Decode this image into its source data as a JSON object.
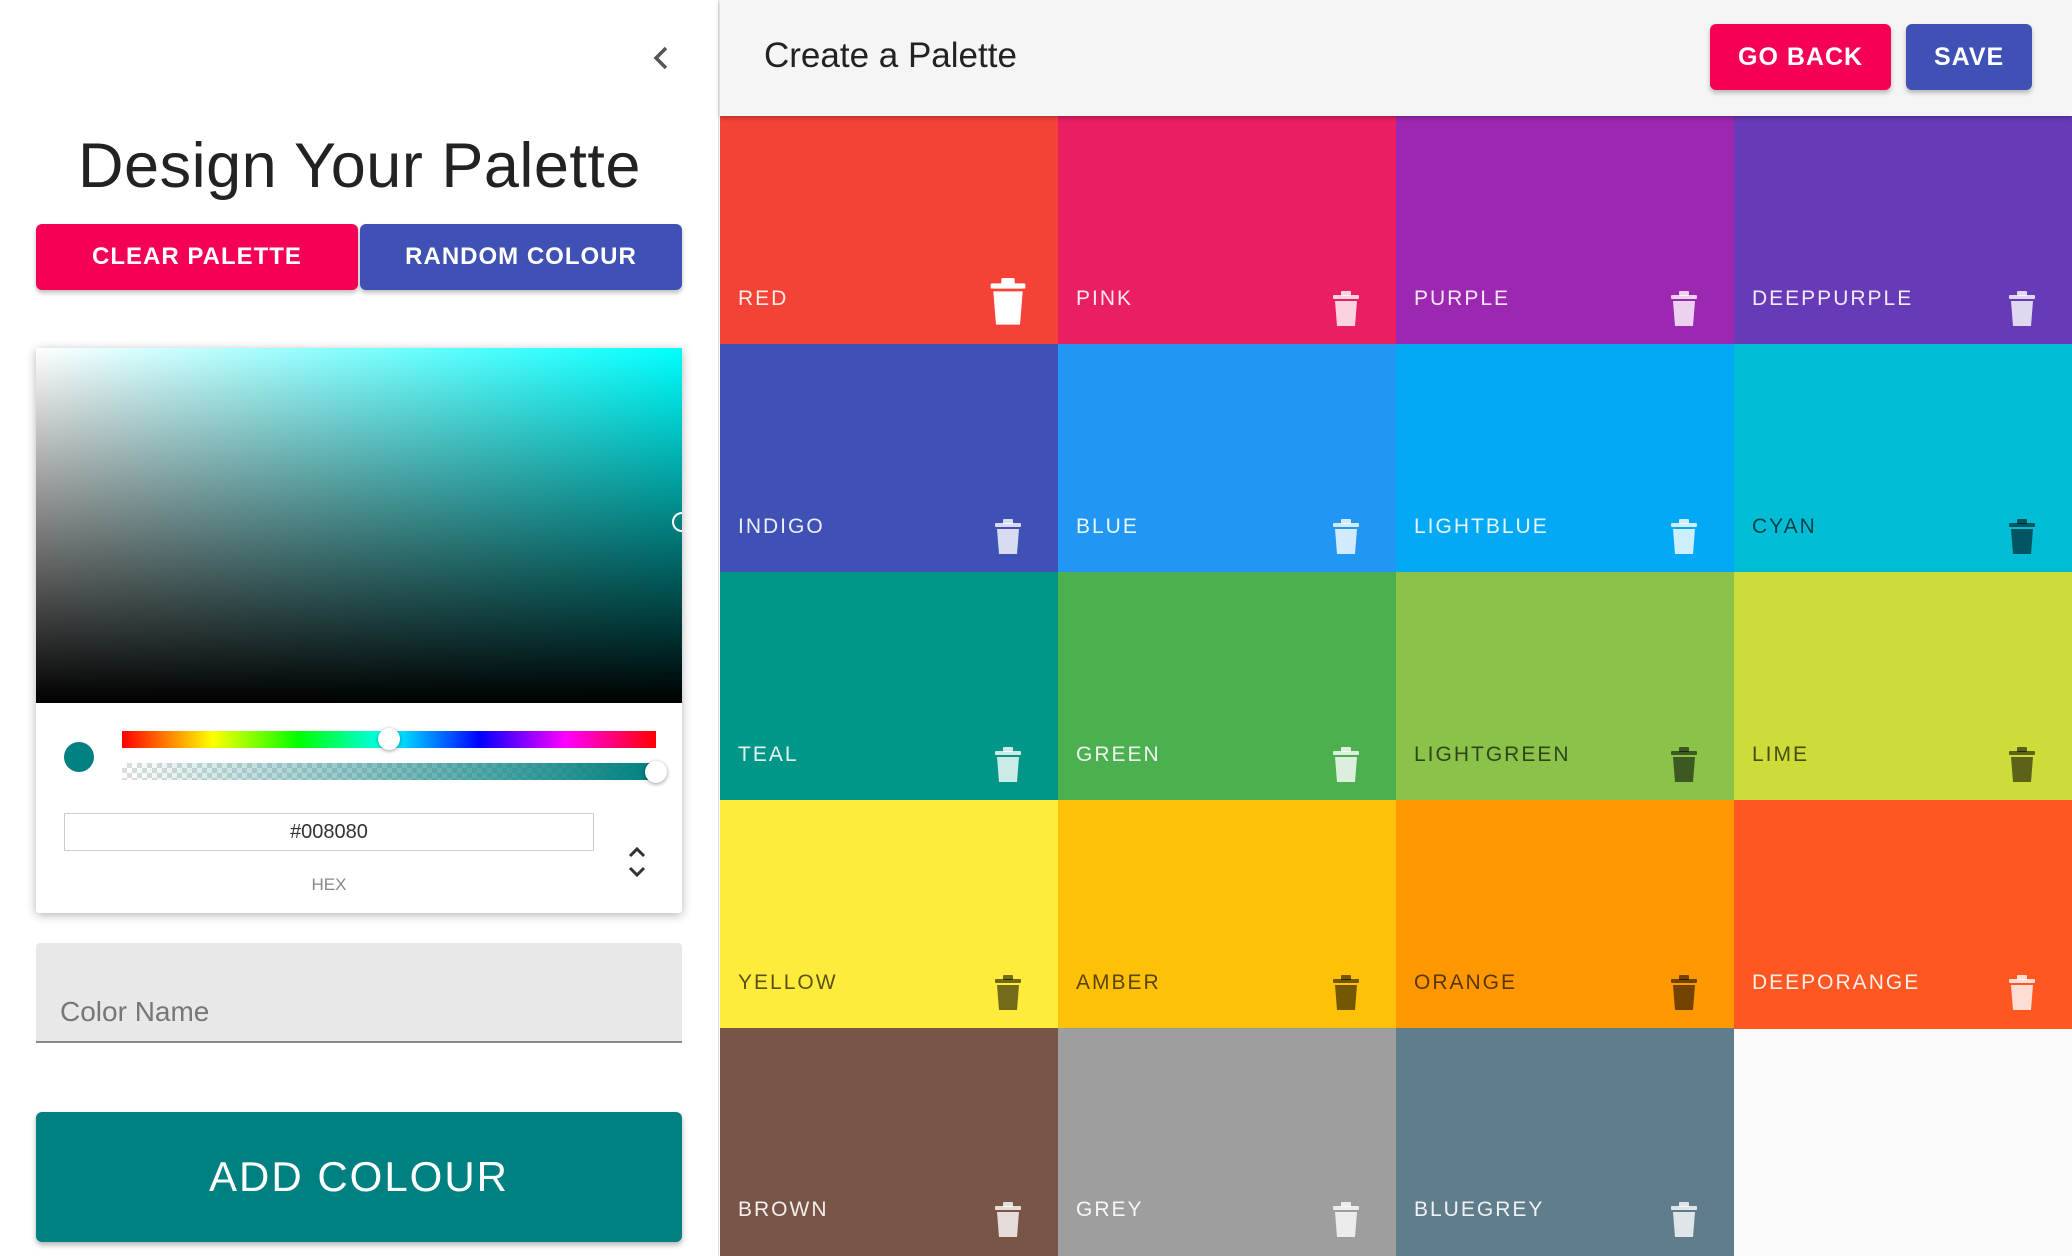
{
  "drawer": {
    "title": "Design Your Palette",
    "clear_label": "CLEAR PALETTE",
    "random_label": "RANDOM COLOUR",
    "collapse_icon": "chevron-left-icon"
  },
  "picker": {
    "hex_value": "#008080",
    "hex_label": "HEX",
    "current_color": "#008080",
    "hue_level": 0.5,
    "alpha_level": 1.0,
    "toggle_icon": "unfold-icon"
  },
  "name_field": {
    "placeholder": "Color Name"
  },
  "add_label": "ADD COLOUR",
  "appbar": {
    "title": "Create a Palette",
    "back_label": "GO BACK",
    "save_label": "SAVE",
    "back_color": "#f50057",
    "save_color": "#3f51b5"
  },
  "colors": [
    {
      "name": "RED",
      "hex": "#f44336",
      "text": "light"
    },
    {
      "name": "PINK",
      "hex": "#e91e63",
      "text": "light"
    },
    {
      "name": "PURPLE",
      "hex": "#9c27b0",
      "text": "light"
    },
    {
      "name": "DEEPPURPLE",
      "hex": "#673ab7",
      "text": "light"
    },
    {
      "name": "INDIGO",
      "hex": "#3f51b5",
      "text": "light"
    },
    {
      "name": "BLUE",
      "hex": "#2196f3",
      "text": "light"
    },
    {
      "name": "LIGHTBLUE",
      "hex": "#03a9f4",
      "text": "light"
    },
    {
      "name": "CYAN",
      "hex": "#00bcd4",
      "text": "dark"
    },
    {
      "name": "TEAL",
      "hex": "#009688",
      "text": "light"
    },
    {
      "name": "GREEN",
      "hex": "#4caf50",
      "text": "light"
    },
    {
      "name": "LIGHTGREEN",
      "hex": "#8bc34a",
      "text": "dark"
    },
    {
      "name": "LIME",
      "hex": "#cddc39",
      "text": "dark"
    },
    {
      "name": "YELLOW",
      "hex": "#ffeb3b",
      "text": "dark"
    },
    {
      "name": "AMBER",
      "hex": "#ffc107",
      "text": "dark"
    },
    {
      "name": "ORANGE",
      "hex": "#ff9800",
      "text": "dark"
    },
    {
      "name": "DEEPORANGE",
      "hex": "#ff5722",
      "text": "light"
    },
    {
      "name": "BROWN",
      "hex": "#795548",
      "text": "light"
    },
    {
      "name": "GREY",
      "hex": "#9e9e9e",
      "text": "light"
    },
    {
      "name": "BLUEGREY",
      "hex": "#607d8b",
      "text": "light"
    }
  ]
}
